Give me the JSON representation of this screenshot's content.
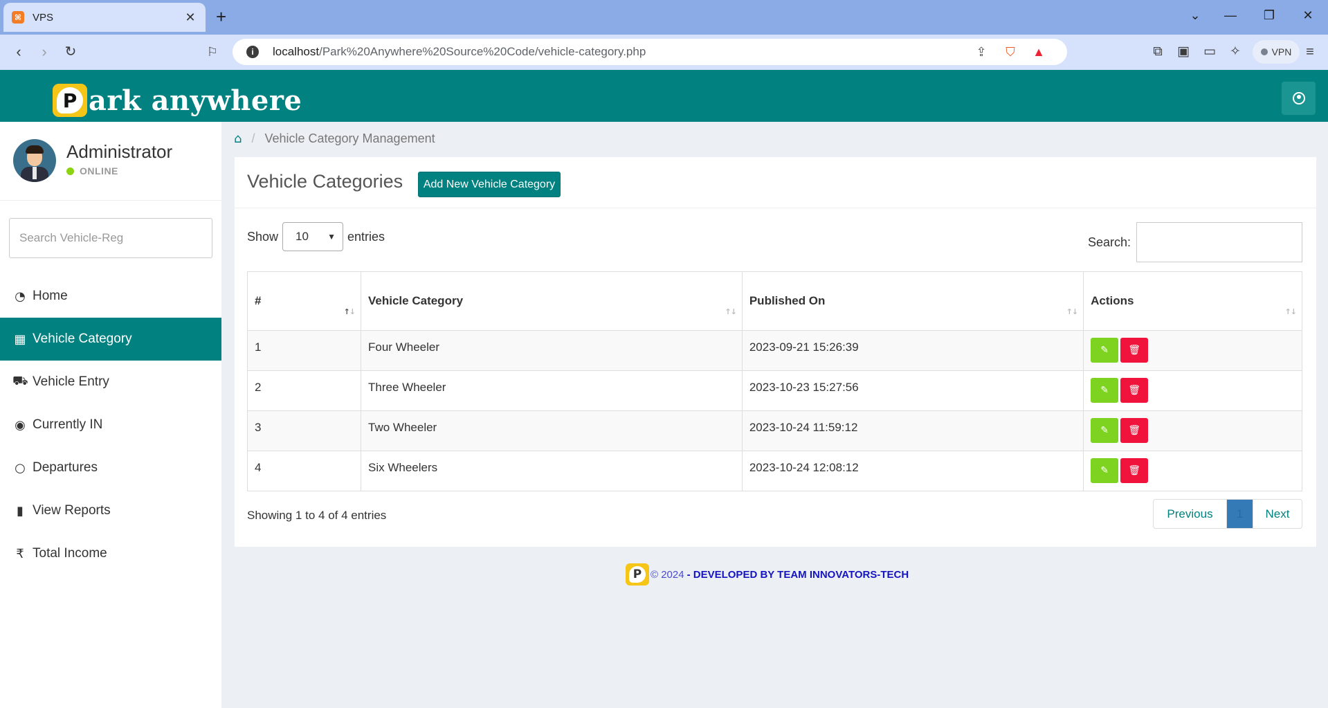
{
  "browser": {
    "tab_title": "VPS",
    "tab_close": "✕",
    "new_tab": "+",
    "url_host": "localhost",
    "url_path": "/Park%20Anywhere%20Source%20Code/vehicle-category.php",
    "vpn_label": "VPN"
  },
  "header": {
    "logo_letter": "P",
    "logo_text": "ark anywhere"
  },
  "sidebar": {
    "user_name": "Administrator",
    "user_status": "ONLINE",
    "search_placeholder": "Search Vehicle-Reg",
    "items": [
      {
        "label": "Home",
        "icon": "dashboard-icon"
      },
      {
        "label": "Vehicle Category",
        "icon": "grid-icon",
        "active": true
      },
      {
        "label": "Vehicle Entry",
        "icon": "car-icon"
      },
      {
        "label": "Currently IN",
        "icon": "toggle-on-icon"
      },
      {
        "label": "Departures",
        "icon": "toggle-off-icon"
      },
      {
        "label": "View Reports",
        "icon": "file-icon"
      },
      {
        "label": "Total Income",
        "icon": "rupee-icon"
      }
    ]
  },
  "breadcrumb": {
    "current": "Vehicle Category Management"
  },
  "main": {
    "title": "Vehicle Categories",
    "add_button": "Add New Vehicle Category",
    "show_label": "Show",
    "show_value": "10",
    "entries_label": "entries",
    "search_label": "Search:",
    "columns": [
      "#",
      "Vehicle Category",
      "Published On",
      "Actions"
    ],
    "rows": [
      {
        "num": "1",
        "category": "Four Wheeler",
        "published": "2023-09-21 15:26:39"
      },
      {
        "num": "2",
        "category": "Three Wheeler",
        "published": "2023-10-23 15:27:56"
      },
      {
        "num": "3",
        "category": "Two Wheeler",
        "published": "2023-10-24 11:59:12"
      },
      {
        "num": "4",
        "category": "Six Wheelers",
        "published": "2023-10-24 12:08:12"
      }
    ],
    "showing": "Showing 1 to 4 of 4 entries",
    "pager": {
      "previous": "Previous",
      "current": "1",
      "next": "Next"
    }
  },
  "footer": {
    "badge_letter": "P",
    "copyright": "© 2024",
    "developer": "- DEVELOPED BY TEAM INNOVATORS-TECH"
  },
  "colors": {
    "brand_teal": "#018180",
    "edit_green": "#7ed321",
    "delete_red": "#f0143c",
    "logo_yellow": "#f5c518"
  }
}
